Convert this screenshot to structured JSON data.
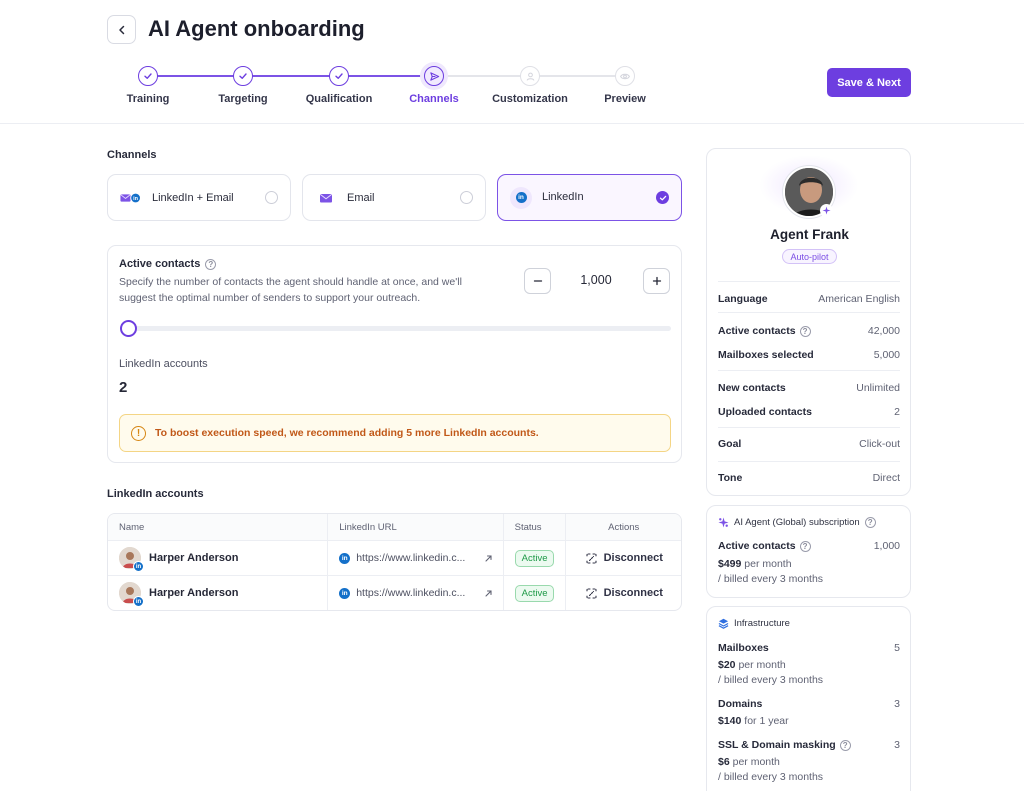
{
  "header": {
    "title": "AI Agent onboarding",
    "save_label": "Save & Next",
    "steps": [
      {
        "label": "Training",
        "state": "done"
      },
      {
        "label": "Targeting",
        "state": "done"
      },
      {
        "label": "Qualification",
        "state": "done"
      },
      {
        "label": "Channels",
        "state": "current"
      },
      {
        "label": "Customization",
        "state": "todo"
      },
      {
        "label": "Preview",
        "state": "todo"
      }
    ]
  },
  "channels": {
    "section_label": "Channels",
    "options": [
      {
        "label": "LinkedIn + Email",
        "selected": false
      },
      {
        "label": "Email",
        "selected": false
      },
      {
        "label": "LinkedIn",
        "selected": true
      }
    ]
  },
  "active_contacts": {
    "title": "Active contacts",
    "description": "Specify the number of contacts the agent should handle at once, and we'll suggest the optimal number of senders to support your outreach.",
    "value": "1,000",
    "slider_fraction": 0.0,
    "linkedin_accounts_label": "LinkedIn accounts",
    "linkedin_accounts_value": "2",
    "warning": "To boost execution speed, we recommend adding 5 more LinkedIn accounts."
  },
  "accounts_table": {
    "section_label": "LinkedIn accounts",
    "columns": [
      "Name",
      "LinkedIn URL",
      "Status",
      "Actions"
    ],
    "rows": [
      {
        "name": "Harper Anderson",
        "url": "https://www.linkedin.c...",
        "status": "Active",
        "action": "Disconnect"
      },
      {
        "name": "Harper Anderson",
        "url": "https://www.linkedin.c...",
        "status": "Active",
        "action": "Disconnect"
      }
    ]
  },
  "agent": {
    "name": "Agent Frank",
    "mode": "Auto-pilot",
    "details": [
      {
        "label": "Language",
        "value": "American English"
      },
      {
        "label": "Active contacts",
        "value": "42,000"
      },
      {
        "label": "Mailboxes selected",
        "value": "5,000"
      },
      {
        "label": "New contacts",
        "value": "Unlimited"
      },
      {
        "label": "Uploaded contacts",
        "value": "2"
      },
      {
        "label": "Goal",
        "value": "Click-out"
      },
      {
        "label": "Tone",
        "value": "Direct"
      }
    ]
  },
  "subscription": {
    "title": "AI Agent (Global) subscription",
    "item_label": "Active contacts",
    "item_value": "1,000",
    "price": "$499",
    "price_unit": " per month",
    "billing": "/ billed every 3 months"
  },
  "infrastructure": {
    "title": "Infrastructure",
    "mailboxes_label": "Mailboxes",
    "mailboxes_value": "5",
    "mailboxes_price": "$20",
    "mailboxes_unit": " per month",
    "mailboxes_billing": "/ billed every 3 months",
    "domains_label": "Domains",
    "domains_value": "3",
    "domains_price": "$140",
    "domains_unit": " for 1 year",
    "ssl_label": "SSL & Domain masking",
    "ssl_value": "3",
    "ssl_price": "$6",
    "ssl_unit": " per month",
    "ssl_billing": "/ billed every 3 months"
  },
  "colors": {
    "accent": "#6d3ee0",
    "linkedin": "#1470c9",
    "warning_text": "#c15818",
    "status_active": "#1f9a48"
  }
}
